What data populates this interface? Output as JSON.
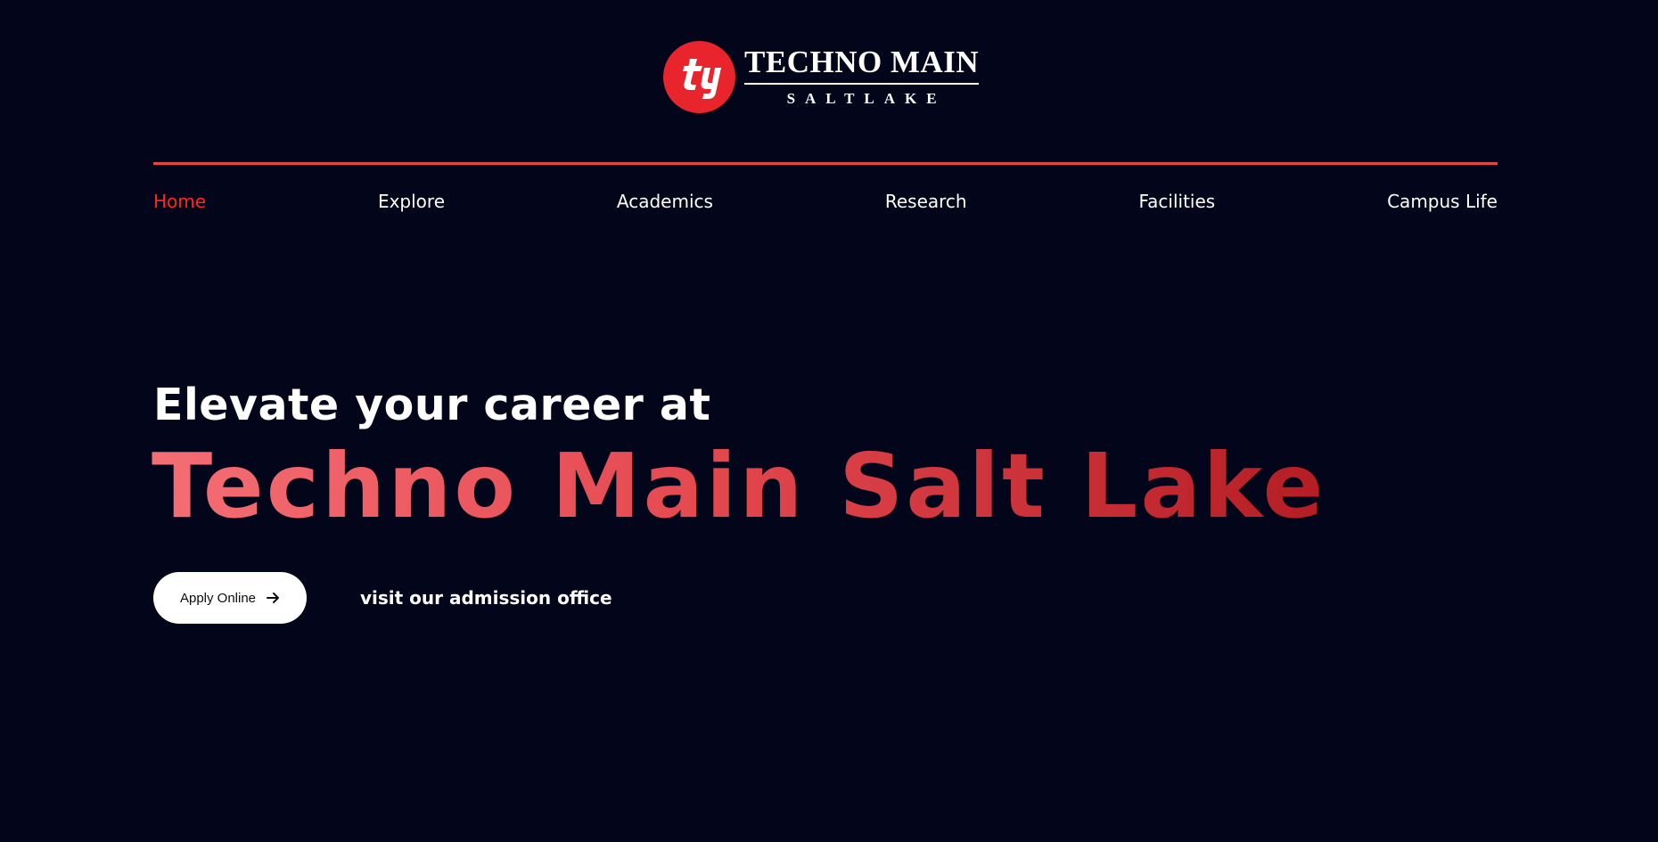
{
  "brand": {
    "name": "TECHNO MAIN",
    "subname": "SALTLAKE",
    "logo_icon": "techno-india-logo-icon",
    "logo_color": "#e8242c"
  },
  "nav": {
    "items": [
      {
        "label": "Home",
        "active": true
      },
      {
        "label": "Explore",
        "active": false
      },
      {
        "label": "Academics",
        "active": false
      },
      {
        "label": "Research",
        "active": false
      },
      {
        "label": "Facilities",
        "active": false
      },
      {
        "label": "Campus Life",
        "active": false
      }
    ],
    "active_color": "#ff2424",
    "rule_color": "#e8434a"
  },
  "hero": {
    "kicker": "Elevate your career at",
    "title": "Techno Main Salt Lake",
    "title_gradient": [
      "#f46e74",
      "#e54a51",
      "#b51d24"
    ]
  },
  "cta": {
    "apply_label": "Apply Online",
    "apply_icon": "arrow-right-icon",
    "visit_label": "visit our admission office"
  },
  "colors": {
    "background": "#03051a",
    "text": "#ffffff"
  }
}
